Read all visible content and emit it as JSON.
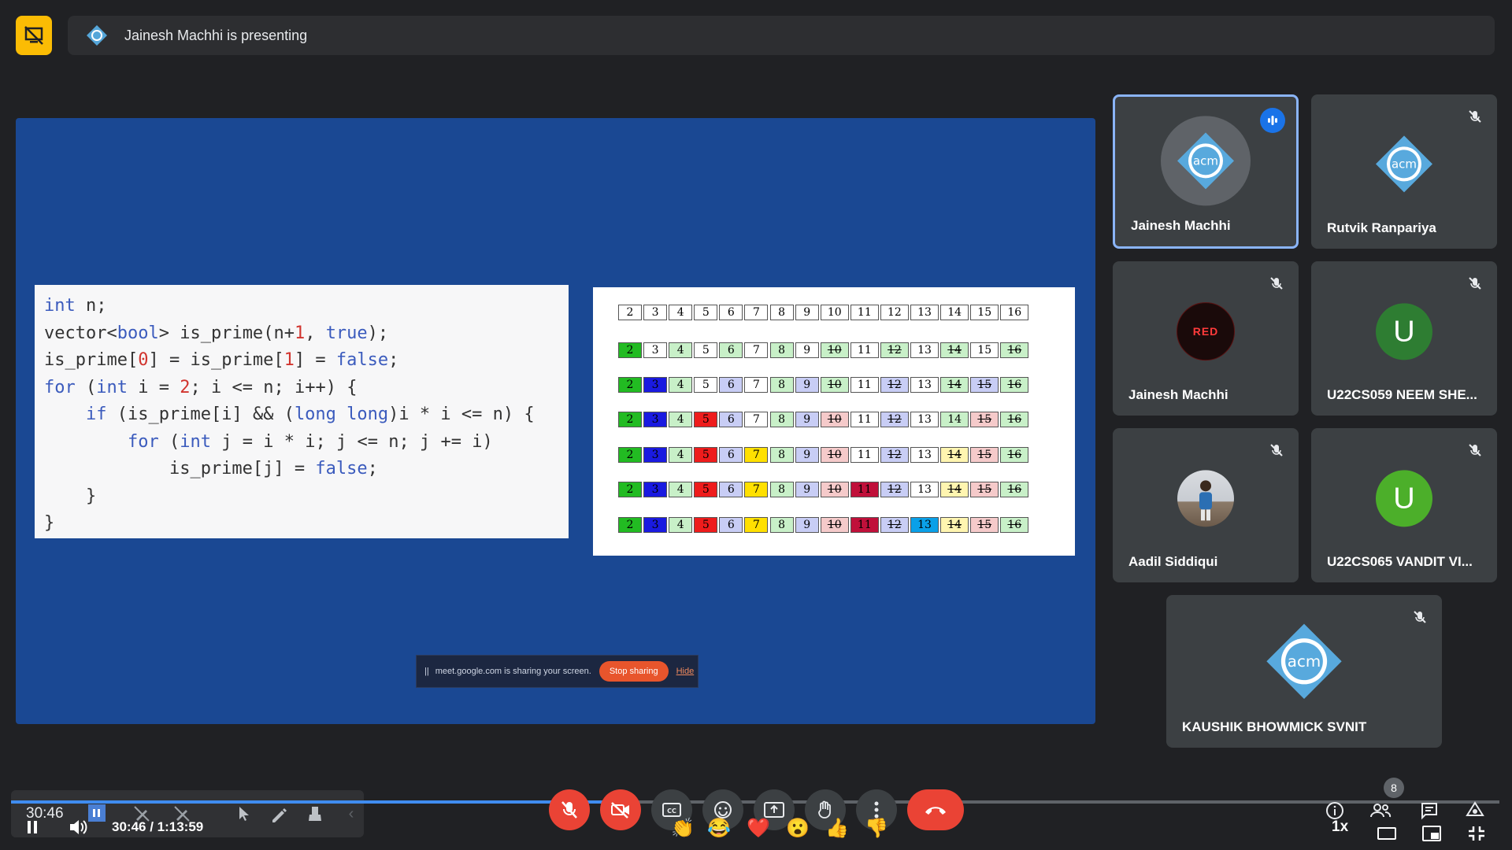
{
  "banner": {
    "text": "Jainesh Machhi is presenting"
  },
  "code": {
    "lines": [
      "int n;",
      "vector<bool> is_prime(n+1, true);",
      "is_prime[0] = is_prime[1] = false;",
      "for (int i = 2; i <= n; i++) {",
      "    if (is_prime[i] && (long long)i * i <= n) {",
      "        for (int j = i * i; j <= n; j += i)",
      "            is_prime[j] = false;",
      "    }",
      "}"
    ]
  },
  "sieve": {
    "numbers": [
      "2",
      "3",
      "4",
      "5",
      "6",
      "7",
      "8",
      "9",
      "10",
      "11",
      "12",
      "13",
      "14",
      "15",
      "16"
    ],
    "rows": [
      {
        "colors": [
          "#fff",
          "#fff",
          "#fff",
          "#fff",
          "#fff",
          "#fff",
          "#fff",
          "#fff",
          "#fff",
          "#fff",
          "#fff",
          "#fff",
          "#fff",
          "#fff",
          "#fff"
        ],
        "struck": []
      },
      {
        "colors": [
          "#22bb22",
          "#fff",
          "#c8f0c8",
          "#fff",
          "#c8f0c8",
          "#fff",
          "#c8f0c8",
          "#fff",
          "#c8f0c8",
          "#fff",
          "#c8f0c8",
          "#fff",
          "#c8f0c8",
          "#fff",
          "#c8f0c8"
        ],
        "struck": [
          "10",
          "12",
          "14",
          "16"
        ]
      },
      {
        "colors": [
          "#22bb22",
          "#1a1ae0",
          "#c8f0c8",
          "#fff",
          "#c8cdf5",
          "#fff",
          "#c8f0c8",
          "#c8cdf5",
          "#c8f0c8",
          "#fff",
          "#c8cdf5",
          "#fff",
          "#c8f0c8",
          "#c8cdf5",
          "#c8f0c8"
        ],
        "struck": [
          "10",
          "12",
          "14",
          "15",
          "16"
        ]
      },
      {
        "colors": [
          "#22bb22",
          "#1a1ae0",
          "#c8f0c8",
          "#ee1c1c",
          "#c8cdf5",
          "#fff",
          "#c8f0c8",
          "#c8cdf5",
          "#f5caca",
          "#fff",
          "#c8cdf5",
          "#fff",
          "#c8f0c8",
          "#f5caca",
          "#c8f0c8"
        ],
        "struck": [
          "10",
          "12",
          "15",
          "16"
        ]
      },
      {
        "colors": [
          "#22bb22",
          "#1a1ae0",
          "#c8f0c8",
          "#ee1c1c",
          "#c8cdf5",
          "#ffe000",
          "#c8f0c8",
          "#c8cdf5",
          "#f5caca",
          "#fff",
          "#c8cdf5",
          "#fff",
          "#fff5b0",
          "#f5caca",
          "#c8f0c8"
        ],
        "struck": [
          "10",
          "12",
          "14",
          "15",
          "16"
        ]
      },
      {
        "colors": [
          "#22bb22",
          "#1a1ae0",
          "#c8f0c8",
          "#ee1c1c",
          "#c8cdf5",
          "#ffe000",
          "#c8f0c8",
          "#c8cdf5",
          "#f5caca",
          "#c0103a",
          "#c8cdf5",
          "#fff",
          "#fff5b0",
          "#f5caca",
          "#c8f0c8"
        ],
        "struck": [
          "10",
          "12",
          "14",
          "15",
          "16"
        ]
      },
      {
        "colors": [
          "#22bb22",
          "#1a1ae0",
          "#c8f0c8",
          "#ee1c1c",
          "#c8cdf5",
          "#ffe000",
          "#c8f0c8",
          "#c8cdf5",
          "#f5caca",
          "#c0103a",
          "#c8cdf5",
          "#0aa0e8",
          "#fff5b0",
          "#f5caca",
          "#c8f0c8"
        ],
        "struck": [
          "10",
          "12",
          "14",
          "15",
          "16"
        ]
      }
    ]
  },
  "sharebar": {
    "text": "meet.google.com is sharing your screen.",
    "stop": "Stop sharing",
    "hide": "Hide"
  },
  "participants": [
    {
      "name": "Jainesh Machhi",
      "avatar": "acm-logo",
      "state": "speaking"
    },
    {
      "name": "Rutvik Ranpariya",
      "avatar": "acm-logo",
      "state": "muted"
    },
    {
      "name": "Jainesh Machhi",
      "avatar": "red-logo",
      "avatar_text": "RED",
      "state": "muted"
    },
    {
      "name": "U22CS059 NEEM SHE...",
      "avatar": "letter",
      "letter": "U",
      "color": "#2e7d32",
      "state": "muted"
    },
    {
      "name": "Aadil Siddiqui",
      "avatar": "photo",
      "state": "muted"
    },
    {
      "name": "U22CS065 VANDIT VI...",
      "avatar": "letter",
      "letter": "U",
      "color": "#4caf2a",
      "state": "muted"
    },
    {
      "name": "KAUSHIK BHOWMICK SVNIT",
      "avatar": "acm-logo",
      "state": "muted"
    }
  ],
  "acm": {
    "text": "acm"
  },
  "player": {
    "elapsed": "30:46",
    "time": "30:46 / 1:13:59",
    "progress": 0.416,
    "speed": "1x",
    "people_count": "8"
  },
  "colors": {
    "accent": "#1a73e8",
    "end_call": "#ea4335",
    "brand_yellow": "#fbbc04"
  }
}
